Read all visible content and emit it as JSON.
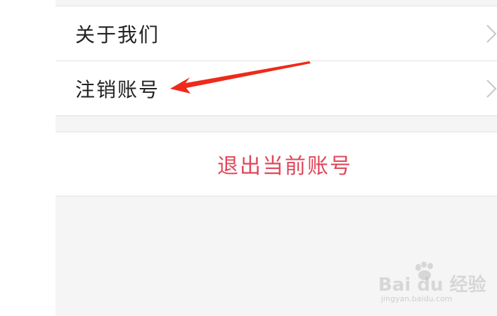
{
  "settings": {
    "items": [
      {
        "label": "关于我们",
        "icon": "chevron-right-icon"
      },
      {
        "label": "注销账号",
        "icon": "chevron-right-icon"
      }
    ]
  },
  "logout": {
    "label": "退出当前账号",
    "color": "#e0475a"
  },
  "annotation": {
    "arrow_color": "#ee2a1b",
    "points_to": "注销账号"
  },
  "watermark": {
    "brand": "Bai du 经验",
    "sub": "jingyan.baidu.com"
  },
  "colors": {
    "background": "#f5f5f5",
    "card": "#ffffff",
    "divider": "#e3e3e3",
    "text": "#222222",
    "chevron": "#c7c7cc"
  }
}
